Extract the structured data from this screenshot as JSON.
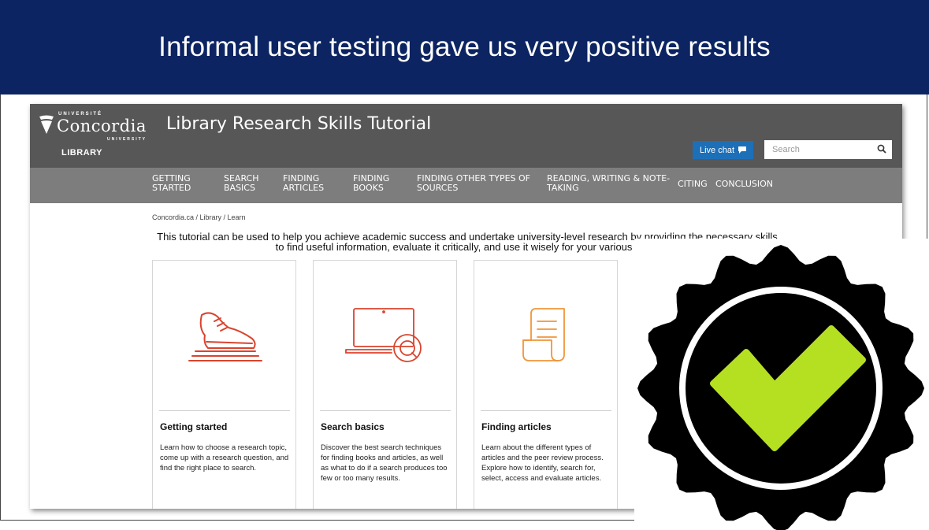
{
  "slide": {
    "title": "Informal user testing gave us very positive results",
    "header_color": "#0c2461"
  },
  "website": {
    "logo": {
      "university_top": "UNIVERSITÉ",
      "name": "Concordia",
      "university_bottom": "UNIVERSITY",
      "department": "LIBRARY"
    },
    "site_title": "Library Research Skills Tutorial",
    "live_chat_label": "Live chat",
    "search": {
      "placeholder": "Search",
      "icon": "search-icon"
    },
    "nav": [
      "GETTING STARTED",
      "SEARCH BASICS",
      "FINDING ARTICLES",
      "FINDING BOOKS",
      "FINDING OTHER TYPES OF SOURCES",
      "READING, WRITING & NOTE-TAKING",
      "CITING",
      "CONCLUSION"
    ],
    "breadcrumb": "Concordia.ca  /  Library  /  Learn",
    "intro_line1": "This tutorial can be used to help you achieve academic success and undertake university-level research by providing the necessary skills",
    "intro_line2": "to find useful information, evaluate it critically, and use it wisely for your various assig",
    "cards": [
      {
        "icon": "running-shoe-icon",
        "title": "Getting started",
        "description": "Learn how to choose a research topic, come up with a research question, and find the right place to search."
      },
      {
        "icon": "laptop-magnifier-icon",
        "title": "Search basics",
        "description": "Discover the best search techniques for finding books and articles, as well as what to do if a search produces too few or too many results."
      },
      {
        "icon": "document-scroll-icon",
        "title": "Finding articles",
        "description": "Learn about the different types of articles and the peer review process. Explore how to identify, search for, select, access and evaluate articles."
      }
    ],
    "colors": {
      "topbar": "#575757",
      "navbar": "#7d7d7d",
      "live_chat": "#1d6fb8",
      "icon_red": "#d9442e",
      "icon_orange": "#f0953a"
    }
  },
  "overlay_badge": {
    "icon": "checkmark-badge-icon",
    "check_color": "#b5e022"
  }
}
